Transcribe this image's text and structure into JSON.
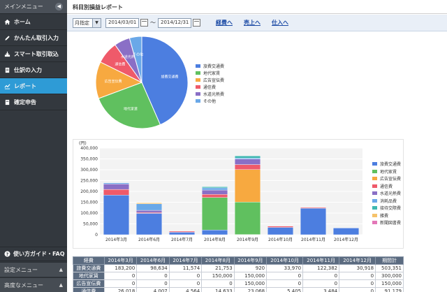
{
  "sidebar": {
    "main_menu": "メインメニュー",
    "items": [
      {
        "label": "ホーム",
        "icon": "home-icon",
        "active": false
      },
      {
        "label": "かんたん取引入力",
        "icon": "pencil-icon",
        "active": false
      },
      {
        "label": "スマート取引取込",
        "icon": "import-icon",
        "active": false
      },
      {
        "label": "仕訳の入力",
        "icon": "journal-icon",
        "active": false
      },
      {
        "label": "レポート",
        "icon": "chart-icon",
        "active": true
      },
      {
        "label": "確定申告",
        "icon": "document-icon",
        "active": false
      }
    ],
    "guide": "使い方ガイド・FAQ",
    "settings_menu": "設定メニュー",
    "advanced_menu": "高度なメニュー"
  },
  "header": {
    "title": "科目別損益レポート"
  },
  "toolbar": {
    "period_select": "月指定",
    "start_date": "2014/03/01",
    "tilde": "～",
    "end_date": "2014/12/31",
    "links": [
      "経費へ",
      "売上へ",
      "仕入へ"
    ]
  },
  "chart_data": [
    {
      "type": "pie",
      "legend_position": "right",
      "categories": [
        "旅費交通費",
        "地代家賃",
        "広告宣伝費",
        "通信費",
        "水道光熱費",
        "その他"
      ],
      "values": [
        503351,
        300000,
        150000,
        91179,
        64000,
        50000
      ],
      "colors": [
        "#4c7ee0",
        "#60c05f",
        "#f7a940",
        "#ef5a6a",
        "#8a6fc6",
        "#6aa8e8"
      ]
    },
    {
      "type": "bar",
      "stacked": true,
      "y_unit": "(円)",
      "ylim": [
        0,
        400000
      ],
      "yticks": [
        0,
        50000,
        100000,
        150000,
        200000,
        250000,
        300000,
        350000,
        400000
      ],
      "ytick_labels": [
        "0",
        "50,000",
        "100,000",
        "150,000",
        "200,000",
        "250,000",
        "300,000",
        "350,000",
        "400,000"
      ],
      "categories": [
        "2014年3月",
        "2014年6月",
        "2014年7月",
        "2014年8月",
        "2014年9月",
        "2014年10月",
        "2014年11月",
        "2014年12月"
      ],
      "legend_position": "right",
      "series": [
        {
          "name": "旅費交通費",
          "color": "#4c7ee0",
          "values": [
            183200,
            98634,
            11574,
            21753,
            920,
            33970,
            122382,
            30918
          ]
        },
        {
          "name": "地代家賃",
          "color": "#60c05f",
          "values": [
            0,
            0,
            0,
            150000,
            150000,
            0,
            0,
            0
          ]
        },
        {
          "name": "広告宣伝費",
          "color": "#f7a940",
          "values": [
            0,
            0,
            0,
            0,
            150000,
            0,
            0,
            0
          ]
        },
        {
          "name": "通信費",
          "color": "#ef5a6a",
          "values": [
            26018,
            4007,
            4564,
            14633,
            23068,
            5405,
            3484,
            0
          ]
        },
        {
          "name": "水道光熱費",
          "color": "#8a6fc6",
          "values": [
            25000,
            10000,
            0,
            20000,
            25000,
            0,
            0,
            0
          ]
        },
        {
          "name": "消耗品費",
          "color": "#6aa8e8",
          "values": [
            5000,
            30000,
            0,
            10000,
            5000,
            0,
            0,
            0
          ]
        },
        {
          "name": "接待交際費",
          "color": "#3fb8b0",
          "values": [
            0,
            0,
            0,
            5000,
            10000,
            0,
            0,
            0
          ]
        },
        {
          "name": "雑費",
          "color": "#f5c26b",
          "values": [
            0,
            5000,
            0,
            0,
            0,
            0,
            0,
            0
          ]
        },
        {
          "name": "新聞図書費",
          "color": "#e377b8",
          "values": [
            0,
            0,
            0,
            0,
            0,
            0,
            0,
            0
          ]
        }
      ]
    }
  ],
  "table": {
    "headers": [
      "経費",
      "2014年3月",
      "2014年6月",
      "2014年7月",
      "2014年8月",
      "2014年9月",
      "2014年10月",
      "2014年11月",
      "2014年12月",
      "期間計"
    ],
    "rows": [
      [
        "旅費交通費",
        "183,200",
        "98,634",
        "11,574",
        "21,753",
        "920",
        "33,970",
        "122,382",
        "30,918",
        "503,351"
      ],
      [
        "地代家賃",
        "0",
        "0",
        "0",
        "150,000",
        "150,000",
        "0",
        "0",
        "0",
        "300,000"
      ],
      [
        "広告宣伝費",
        "0",
        "0",
        "0",
        "0",
        "150,000",
        "0",
        "0",
        "0",
        "150,000"
      ],
      [
        "通信費",
        "26,018",
        "4,007",
        "4,564",
        "14,633",
        "23,068",
        "5,405",
        "3,484",
        "0",
        "91,179"
      ]
    ]
  }
}
